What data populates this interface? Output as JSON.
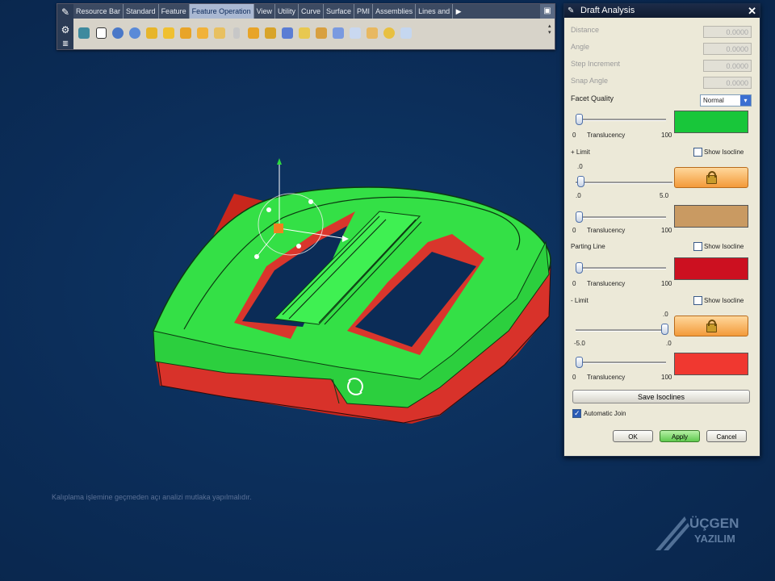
{
  "toolbar": {
    "tabs": [
      "Resource Bar",
      "Standard",
      "Feature",
      "Feature Operation",
      "View",
      "Utility",
      "Curve",
      "Surface",
      "PMI",
      "Assemblies",
      "Lines and"
    ],
    "active_tab": "Feature Operation",
    "more_icon": "right-arrow-icon",
    "icons": [
      "open-icon",
      "box-icon",
      "extrude-icon",
      "revolve-icon",
      "blend-icon",
      "chamfer-icon",
      "shell-icon",
      "draft-icon",
      "hole-icon",
      "pattern-icon",
      "mirror-icon",
      "trim-icon",
      "sew-icon",
      "offset-icon",
      "scale-icon",
      "split-icon",
      "thicken-icon",
      "unite-icon",
      "subtract-icon",
      "intersect-icon"
    ]
  },
  "dialog": {
    "title": "Draft Analysis",
    "distance_label": "Distance",
    "distance_value": "0.0000",
    "angle_label": "Angle",
    "angle_value": "0.0000",
    "step_label": "Step Increment",
    "step_value": "0.0000",
    "snap_label": "Snap Angle",
    "snap_value": "0.0000",
    "facet_label": "Facet Quality",
    "facet_value": "Normal",
    "translucency_label": "Translucency",
    "min": "0",
    "max": "100",
    "plus_limit_label": "+ Limit",
    "show_isoline_label": "Show Isocline",
    "plus_limit_top": ".0",
    "plus_limit_min": ".0",
    "plus_limit_max": "5.0",
    "parting_label": "Parting Line",
    "minus_limit_label": "- Limit",
    "minus_limit_top": ".0",
    "minus_limit_min": "-5.0",
    "minus_limit_max": ".0",
    "save_label": "Save Isoclines",
    "auto_join_label": "Automatic Join",
    "ok_label": "OK",
    "apply_label": "Apply",
    "cancel_label": "Cancel"
  },
  "viewport": {
    "hint": "Kalıplama işlemine geçmeden açı analizi mutlaka yapılmalıdır.",
    "logo_line1": "ÜÇGEN",
    "logo_line2": "YAZILIM"
  },
  "colors": {
    "background": "#0c2f5c",
    "green_face": "#2ed93f",
    "red_face": "#d9362c",
    "tan_face": "#c99a62"
  }
}
